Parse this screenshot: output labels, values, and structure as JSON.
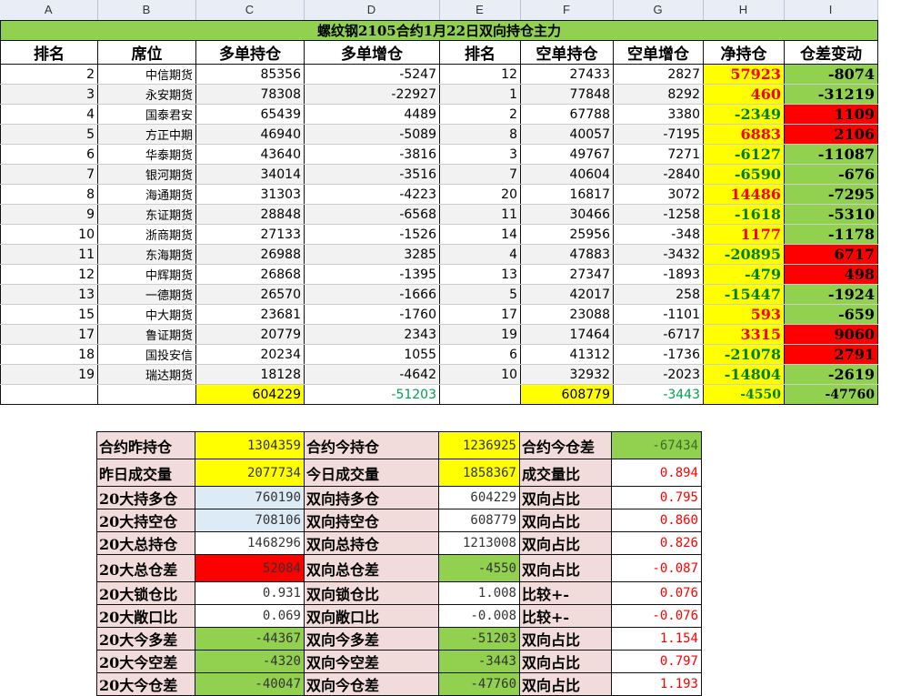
{
  "columns": [
    "A",
    "B",
    "C",
    "D",
    "E",
    "F",
    "G",
    "H",
    "I"
  ],
  "title": "螺纹钢2105合约1月22日双向持仓主力",
  "headers": [
    "排名",
    "席位",
    "多单持仓",
    "多单增仓",
    "排名",
    "空单持仓",
    "空单增仓",
    "净持仓",
    "仓差变动"
  ],
  "rows": [
    {
      "rank": "2",
      "seat": "中信期货",
      "long": "85356",
      "long_chg": "-5247",
      "srank": "12",
      "short": "27433",
      "short_chg": "2827",
      "net": "57923",
      "diff": "-8074"
    },
    {
      "rank": "3",
      "seat": "永安期货",
      "long": "78308",
      "long_chg": "-22927",
      "srank": "1",
      "short": "77848",
      "short_chg": "8292",
      "net": "460",
      "diff": "-31219"
    },
    {
      "rank": "4",
      "seat": "国泰君安",
      "long": "65439",
      "long_chg": "4489",
      "srank": "2",
      "short": "67788",
      "short_chg": "3380",
      "net": "-2349",
      "diff": "1109"
    },
    {
      "rank": "5",
      "seat": "方正中期",
      "long": "46940",
      "long_chg": "-5089",
      "srank": "8",
      "short": "40057",
      "short_chg": "-7195",
      "net": "6883",
      "diff": "2106"
    },
    {
      "rank": "6",
      "seat": "华泰期货",
      "long": "43640",
      "long_chg": "-3816",
      "srank": "3",
      "short": "49767",
      "short_chg": "7271",
      "net": "-6127",
      "diff": "-11087"
    },
    {
      "rank": "7",
      "seat": "银河期货",
      "long": "34014",
      "long_chg": "-3516",
      "srank": "7",
      "short": "40604",
      "short_chg": "-2840",
      "net": "-6590",
      "diff": "-676"
    },
    {
      "rank": "8",
      "seat": "海通期货",
      "long": "31303",
      "long_chg": "-4223",
      "srank": "20",
      "short": "16817",
      "short_chg": "3072",
      "net": "14486",
      "diff": "-7295"
    },
    {
      "rank": "9",
      "seat": "东证期货",
      "long": "28848",
      "long_chg": "-6568",
      "srank": "11",
      "short": "30466",
      "short_chg": "-1258",
      "net": "-1618",
      "diff": "-5310"
    },
    {
      "rank": "10",
      "seat": "浙商期货",
      "long": "27133",
      "long_chg": "-1526",
      "srank": "14",
      "short": "25956",
      "short_chg": "-348",
      "net": "1177",
      "diff": "-1178"
    },
    {
      "rank": "11",
      "seat": "东海期货",
      "long": "26988",
      "long_chg": "3285",
      "srank": "4",
      "short": "47883",
      "short_chg": "-3432",
      "net": "-20895",
      "diff": "6717"
    },
    {
      "rank": "12",
      "seat": "中辉期货",
      "long": "26868",
      "long_chg": "-1395",
      "srank": "13",
      "short": "27347",
      "short_chg": "-1893",
      "net": "-479",
      "diff": "498"
    },
    {
      "rank": "13",
      "seat": "一德期货",
      "long": "26570",
      "long_chg": "-1666",
      "srank": "5",
      "short": "42017",
      "short_chg": "258",
      "net": "-15447",
      "diff": "-1924"
    },
    {
      "rank": "15",
      "seat": "中大期货",
      "long": "23681",
      "long_chg": "-1760",
      "srank": "17",
      "short": "23088",
      "short_chg": "-1101",
      "net": "593",
      "diff": "-659"
    },
    {
      "rank": "17",
      "seat": "鲁证期货",
      "long": "20779",
      "long_chg": "2343",
      "srank": "19",
      "short": "17464",
      "short_chg": "-6717",
      "net": "3315",
      "diff": "9060"
    },
    {
      "rank": "18",
      "seat": "国投安信",
      "long": "20234",
      "long_chg": "1055",
      "srank": "6",
      "short": "41312",
      "short_chg": "-1736",
      "net": "-21078",
      "diff": "2791"
    },
    {
      "rank": "19",
      "seat": "瑞达期货",
      "long": "18128",
      "long_chg": "-4642",
      "srank": "10",
      "short": "32932",
      "short_chg": "-2023",
      "net": "-14804",
      "diff": "-2619"
    }
  ],
  "totals": {
    "long": "604229",
    "long_chg": "-51203",
    "short": "608779",
    "short_chg": "-3443",
    "net": "-4550",
    "diff": "-47760"
  },
  "summary": [
    {
      "l1": "合约昨持仓",
      "v1": "1304359",
      "l2": "合约今持仓",
      "v2": "1236925",
      "l3": "合约今仓差",
      "v3": "-67434"
    },
    {
      "l1": "昨日成交量",
      "v1": "2077734",
      "l2": "今日成交量",
      "v2": "1858367",
      "l3": "成交量比",
      "v3": "0.894"
    },
    {
      "l1": "20大持多仓",
      "v1": "760190",
      "l2": "双向持多仓",
      "v2": "604229",
      "l3": "双向占比",
      "v3": "0.795"
    },
    {
      "l1": "20大持空仓",
      "v1": "708106",
      "l2": "双向持空仓",
      "v2": "608779",
      "l3": "双向占比",
      "v3": "0.860"
    },
    {
      "l1": "20大总持仓",
      "v1": "1468296",
      "l2": "双向总持仓",
      "v2": "1213008",
      "l3": "双向占比",
      "v3": "0.826"
    },
    {
      "l1": "20大总仓差",
      "v1": "52084",
      "l2": "双向总仓差",
      "v2": "-4550",
      "l3": "双向占比",
      "v3": "-0.087"
    },
    {
      "l1": "20大锁仓比",
      "v1": "0.931",
      "l2": "双向锁仓比",
      "v2": "1.008",
      "l3": "比较+-",
      "v3": "0.076"
    },
    {
      "l1": "20大敞口比",
      "v1": "0.069",
      "l2": "双向敞口比",
      "v2": "-0.008",
      "l3": "比较+-",
      "v3": "-0.076"
    },
    {
      "l1": "20大今多差",
      "v1": "-44367",
      "l2": "双向今多差",
      "v2": "-51203",
      "l3": "双向占比",
      "v3": "1.154"
    },
    {
      "l1": "20大今空差",
      "v1": "-4320",
      "l2": "双向今空差",
      "v2": "-3443",
      "l3": "双向占比",
      "v3": "0.797"
    },
    {
      "l1": "20大今仓差",
      "v1": "-40047",
      "l2": "双向今仓差",
      "v2": "-47760",
      "l3": "双向占比",
      "v3": "1.193"
    }
  ]
}
